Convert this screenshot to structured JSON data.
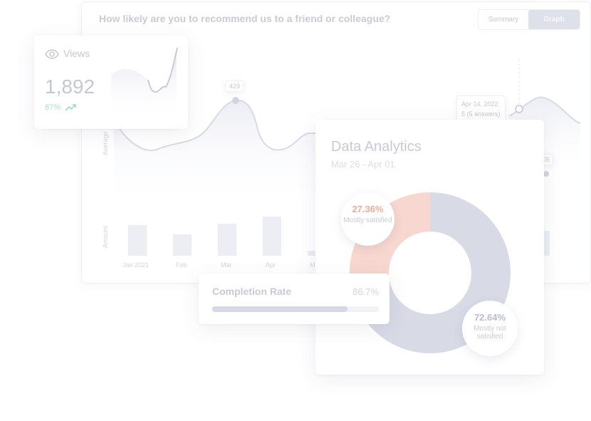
{
  "survey": {
    "question": "How likely are you to recommend us to a friend or colleague?",
    "tabs": {
      "summary": "Summary",
      "graph": "Graph"
    },
    "y_label_top": "Average",
    "y_label_bottom": "Amount",
    "months": [
      "Jan 2021",
      "Feb",
      "Mar",
      "Apr",
      "M"
    ],
    "peak_label": "429",
    "tooltip_date": "Apr 14, 2022",
    "tooltip_answers": "5 (5 answers)",
    "partial_label": "05"
  },
  "views": {
    "icon": "eye-icon",
    "title": "Views",
    "value": "1,892",
    "change": "87%",
    "trend_icon": "trend-up-icon"
  },
  "analytics": {
    "title": "Data Analytics",
    "date_range": "Mar 26 - Apr 01"
  },
  "chart_data": {
    "type": "pie",
    "title": "Data Analytics",
    "subtitle": "Mar 26 - Apr 01",
    "donut": true,
    "slices": [
      {
        "label": "Mostly satisfied",
        "value": 27.36,
        "value_text": "27.36%",
        "color": "#f7d7cf"
      },
      {
        "label": "Mostly not satisfied",
        "value": 72.64,
        "value_text": "72.64%",
        "color": "#d8dae6"
      }
    ]
  },
  "completion": {
    "title": "Completion Rate",
    "value": "86.7%",
    "progress": 0.81
  },
  "colors": {
    "accent": "#c8cce0",
    "positive": "#9fdcc0",
    "salmon": "#efaa9a",
    "slate": "#b9bdd3"
  }
}
